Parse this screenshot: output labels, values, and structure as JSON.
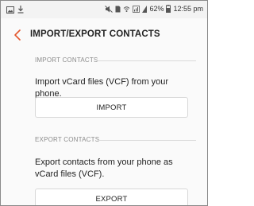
{
  "status_bar": {
    "battery_percent": "62%",
    "time": "12:55 pm"
  },
  "app_bar": {
    "title": "IMPORT/EXPORT CONTACTS"
  },
  "import_section": {
    "header": "IMPORT CONTACTS",
    "description": "Import vCard files (VCF) from your phone.",
    "button_label": "IMPORT"
  },
  "export_section": {
    "header": "EXPORT CONTACTS",
    "description": "Export contacts from your phone as vCard files (VCF).",
    "button_label": "EXPORT"
  },
  "colors": {
    "accent": "#e4572e",
    "section_header": "#8c8c8c"
  }
}
